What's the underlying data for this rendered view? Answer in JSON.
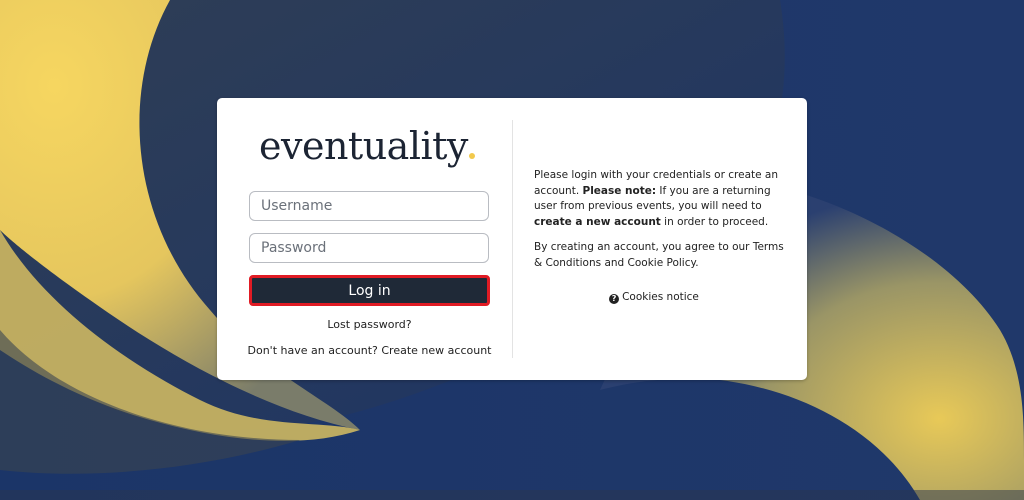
{
  "brand": {
    "logo_text": "eventuality",
    "accent_color": "#f2c94c",
    "primary_color": "#1f2937"
  },
  "login": {
    "username_placeholder": "Username",
    "password_placeholder": "Password",
    "login_label": "Log in",
    "lost_password": "Lost password?",
    "no_account_prefix": "Don't have an account?",
    "create_account": "Create new account"
  },
  "info": {
    "para1_a": "Please login with your credentials or create an account.",
    "para1_bold1": "Please note:",
    "para1_b": "If you are a returning user from previous events, you will need to",
    "para1_bold2": "create a new account",
    "para1_c": "in order to proceed.",
    "para2": "By creating an account, you agree to our Terms & Conditions and Cookie Policy.",
    "cookies_notice": "Cookies notice",
    "question_icon": "question-circle-icon"
  },
  "highlight_color": "#e01b24"
}
